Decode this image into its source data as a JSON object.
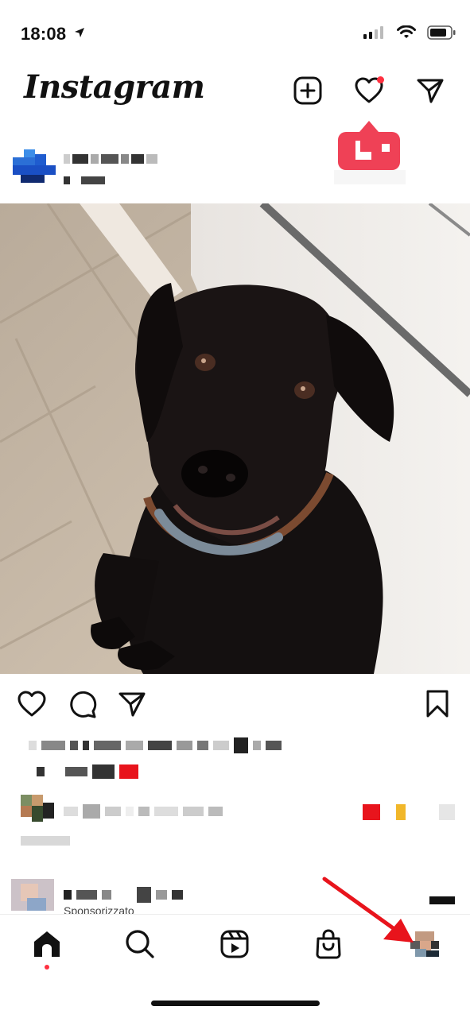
{
  "status": {
    "time": "18:08",
    "icons": [
      "location-arrow-icon",
      "cellular-signal-icon",
      "wifi-icon",
      "battery-icon"
    ]
  },
  "header": {
    "app_title": "Instagram",
    "buttons": [
      "new-post-icon",
      "heart-icon",
      "direct-message-icon"
    ],
    "notification_dot_color": "#ff3040"
  },
  "notification_popup": {
    "color": "#ef4156"
  },
  "post": {
    "photo_description_icon": "dog-photo",
    "actions": [
      "heart-icon",
      "comment-icon",
      "share-icon",
      "bookmark-icon"
    ]
  },
  "sponsored": {
    "label": "Sponsorizzato"
  },
  "tabbar": {
    "tabs": [
      "home-icon",
      "search-icon",
      "reels-icon",
      "shop-icon",
      "profile-avatar"
    ],
    "active": "home-icon"
  },
  "annotation": {
    "arrow_color": "#e8141c",
    "target": "profile-avatar"
  }
}
